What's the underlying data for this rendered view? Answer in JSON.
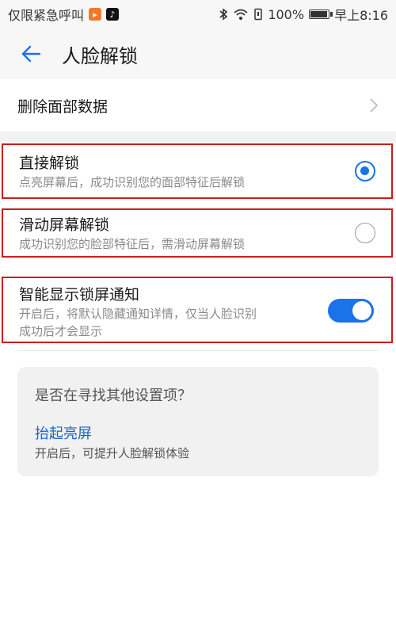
{
  "status_bar": {
    "carrier": "仅限紧急呼叫",
    "battery": "100%",
    "time": "早上8:16",
    "battery_level": 1.0
  },
  "app_bar": {
    "title": "人脸解锁"
  },
  "delete_row": {
    "label": "删除面部数据"
  },
  "options": [
    {
      "title": "直接解锁",
      "subtitle": "点亮屏幕后，成功识别您的面部特征后解锁",
      "selected": true
    },
    {
      "title": "滑动屏幕解锁",
      "subtitle": "成功识别您的脸部特征后，需滑动屏幕解锁",
      "selected": false
    }
  ],
  "notify": {
    "title": "智能显示锁屏通知",
    "subtitle_line1": "开启后，将默认隐藏通知详情，仅当人脸识别",
    "subtitle_line2": "成功后才会显示",
    "enabled": true
  },
  "suggestion": {
    "question": "是否在寻找其他设置项？",
    "link": "抬起亮屏",
    "description": "开启后，可提升人脸解锁体验"
  },
  "colors": {
    "accent": "#1a73e8",
    "highlight_border": "#cc1d1d"
  }
}
